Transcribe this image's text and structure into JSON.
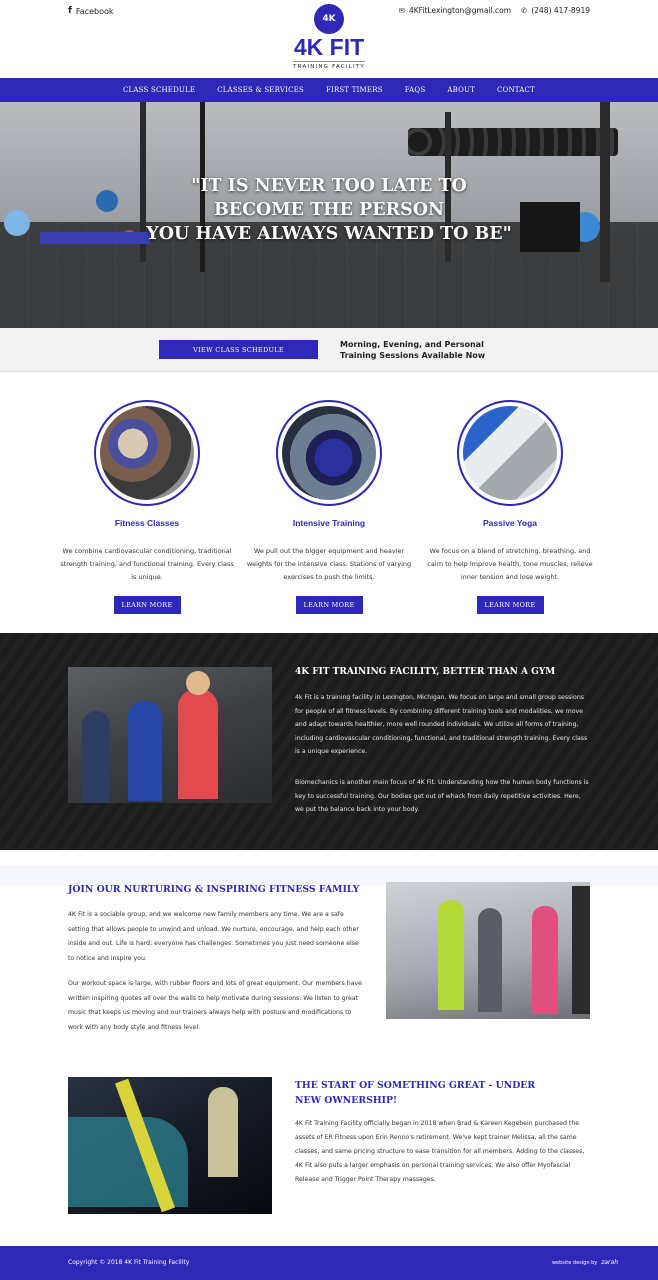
{
  "topbar": {
    "facebook_icon": "facebook-icon",
    "facebook_label": "Facebook",
    "email_icon": "envelope-icon",
    "email": "4KFitLexington@gmail.com",
    "phone_icon": "phone-icon",
    "phone": "(248) 417-8919"
  },
  "logo": {
    "badge": "4K",
    "title": "4K FIT",
    "subtitle": "TRAINING FACILITY",
    "accent_color": "#2f27b5"
  },
  "nav": {
    "items": [
      {
        "label": "CLASS SCHEDULE"
      },
      {
        "label": "CLASSES & SERVICES"
      },
      {
        "label": "FIRST TIMERS"
      },
      {
        "label": "FAQS"
      },
      {
        "label": "ABOUT"
      },
      {
        "label": "CONTACT"
      }
    ]
  },
  "hero": {
    "quote_lines": [
      "\"IT IS NEVER TOO LATE TO",
      "BECOME THE PERSON",
      "YOU HAVE ALWAYS WANTED TO BE\""
    ]
  },
  "strip": {
    "button_label": "VIEW CLASS SCHEDULE",
    "note_line1": "Morning, Evening, and Personal",
    "note_line2": "Training Sessions Available Now"
  },
  "features": [
    {
      "title": "Fitness Classes",
      "text": "We combine cardiovascular conditioning, traditional strength training, and functional training. Every class is unique.",
      "button_label": "LEARN MORE"
    },
    {
      "title": "Intensive Training",
      "text": "We pull out the bigger equipment and heavier weights for the intensive class. Stations of varying exercises to push the limits.",
      "button_label": "LEARN MORE"
    },
    {
      "title": "Passive Yoga",
      "text": "We focus on a blend of stretching, breathing, and calm to help improve health, tone muscles, relieve inner tension and lose weight.",
      "button_label": "LEARN MORE"
    }
  ],
  "better": {
    "heading": "4K FIT TRAINING FACILITY, BETTER THAN A GYM",
    "para1": "4k Fit is a training facility in Lexington, Michigan. We focus on large and small group sessions for people of all fitness levels. By combining different training tools and modalities, we move and adapt towards healthier, more well rounded individuals. We utilize all forms of training, including cardiovascular conditioning, functional, and traditional strength training. Every class is a unique experience.",
    "para2": "Biomechanics is another main focus of 4K Fit. Understanding how the human body functions is key to successful training. Our bodies get out of whack from daily repetitive activities. Here, we put the balance back into your body."
  },
  "nurturing": {
    "heading": "JOIN OUR NURTURING & INSPIRING FITNESS FAMILY",
    "para1": "4K Fit is a sociable group, and we welcome new family members any time. We are a safe setting that allows people to unwind and unload. We nurture, encourage, and help each other inside and out. Life is hard; everyone has challenges. Sometimes you just need someone else to notice and inspire you.",
    "para2": "Our workout space is large, with rubber floors and lots of great equipment. Our members have written inspiring quotes all over the walls to help motivate during sessions. We listen to great music that keeps us moving and our trainers always help with posture and modifications to work with any body style and fitness level."
  },
  "start": {
    "heading": "THE START OF SOMETHING GREAT - UNDER NEW OWNERSHIP!",
    "para": "4K Fit Training Facility officially began in 2018 when Brad & Kareen Kegebein purchased the assets of ER Fitness upon Erin Renno's retirement. We've kept trainer Melissa, all the same classes, and same pricing structure to ease transition for all members. Adding to the classes, 4K Fit also puts a larger emphasis on personal training services. We also offer Myofascial Release and Trigger Point Therapy massages."
  },
  "footer": {
    "copyright": "Copyright © 2018 4K Fit Training Facility",
    "credit_label": "website design by",
    "credit_brand": "zarah"
  }
}
